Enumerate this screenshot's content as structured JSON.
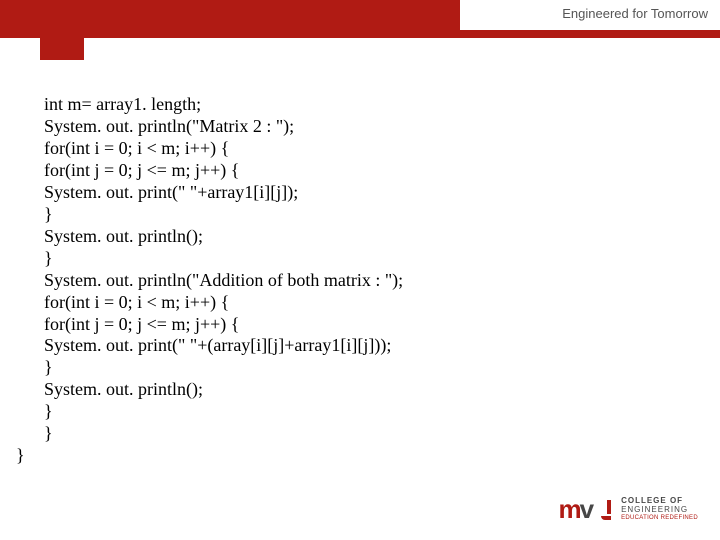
{
  "header": {
    "tagline": "Engineered for Tomorrow"
  },
  "code": {
    "l01": "int m= array1. length;",
    "l02": "System. out. println(\"Matrix 2 : \");",
    "l03": "for(int i = 0; i < m; i++) {",
    "l04": "for(int j = 0; j <= m; j++) {",
    "l05": "System. out. print(\" \"+array1[i][j]);",
    "l06": "}",
    "l07": "System. out. println();",
    "l08": "}",
    "l09": "System. out. println(\"Addition of both matrix : \");",
    "l10": "for(int i = 0; i < m; i++) {",
    "l11": "for(int j = 0; j <= m; j++) {",
    "l12": "System. out. print(\" \"+(array[i][j]+array1[i][j]));",
    "l13": "}",
    "l14": "System. out. println();",
    "l15": "}",
    "l16": "}",
    "l17": "}"
  },
  "footer": {
    "logo_text_line1": "COLLEGE OF",
    "logo_text_line2": "ENGINEERING",
    "logo_text_line3": "EDUCATION REDEFINED"
  }
}
